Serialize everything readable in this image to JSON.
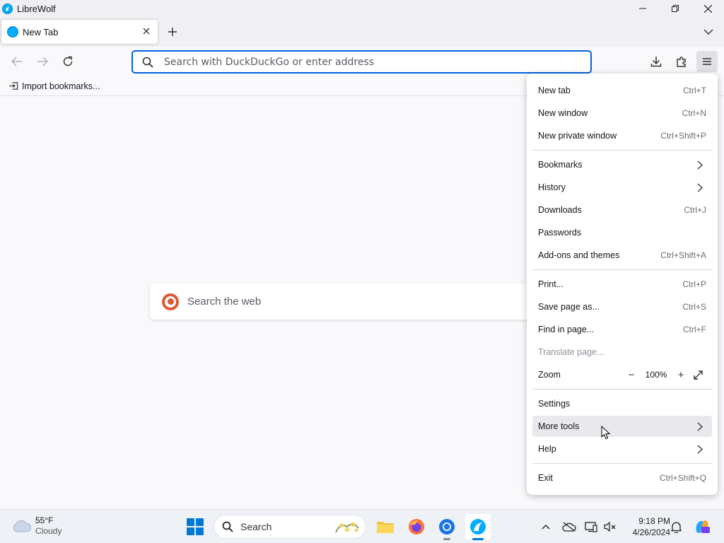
{
  "window": {
    "title": "LibreWolf"
  },
  "tab": {
    "label": "New Tab"
  },
  "urlbar": {
    "placeholder": "Search with DuckDuckGo or enter address"
  },
  "bookmarks": {
    "import_label": "Import bookmarks..."
  },
  "content": {
    "websearch_placeholder": "Search the web"
  },
  "menu": {
    "new_tab": {
      "label": "New tab",
      "shortcut": "Ctrl+T"
    },
    "new_window": {
      "label": "New window",
      "shortcut": "Ctrl+N"
    },
    "new_private_window": {
      "label": "New private window",
      "shortcut": "Ctrl+Shift+P"
    },
    "bookmarks": {
      "label": "Bookmarks"
    },
    "history": {
      "label": "History"
    },
    "downloads": {
      "label": "Downloads",
      "shortcut": "Ctrl+J"
    },
    "passwords": {
      "label": "Passwords"
    },
    "addons": {
      "label": "Add-ons and themes",
      "shortcut": "Ctrl+Shift+A"
    },
    "print": {
      "label": "Print...",
      "shortcut": "Ctrl+P"
    },
    "save_page": {
      "label": "Save page as...",
      "shortcut": "Ctrl+S"
    },
    "find": {
      "label": "Find in page...",
      "shortcut": "Ctrl+F"
    },
    "translate": {
      "label": "Translate page..."
    },
    "zoom": {
      "label": "Zoom",
      "value": "100%",
      "minus": "−",
      "plus": "+"
    },
    "settings": {
      "label": "Settings"
    },
    "more_tools": {
      "label": "More tools"
    },
    "help": {
      "label": "Help"
    },
    "exit": {
      "label": "Exit",
      "shortcut": "Ctrl+Shift+Q"
    }
  },
  "taskbar": {
    "weather": {
      "temp": "55°F",
      "condition": "Cloudy"
    },
    "search_label": "Search",
    "clock": {
      "time": "9:18 PM",
      "date": "4/26/2024"
    }
  },
  "icons": {
    "app_logo": "librewolf-icon",
    "back": "back-arrow-icon",
    "forward": "forward-arrow-icon",
    "reload": "reload-icon",
    "downloads": "download-icon",
    "extensions": "puzzle-icon",
    "menu": "hamburger-icon"
  },
  "colors": {
    "accent": "#0061e0",
    "librewolf": "#00acff",
    "duckduckgo": "#de5833",
    "windows": "#0078d4"
  }
}
